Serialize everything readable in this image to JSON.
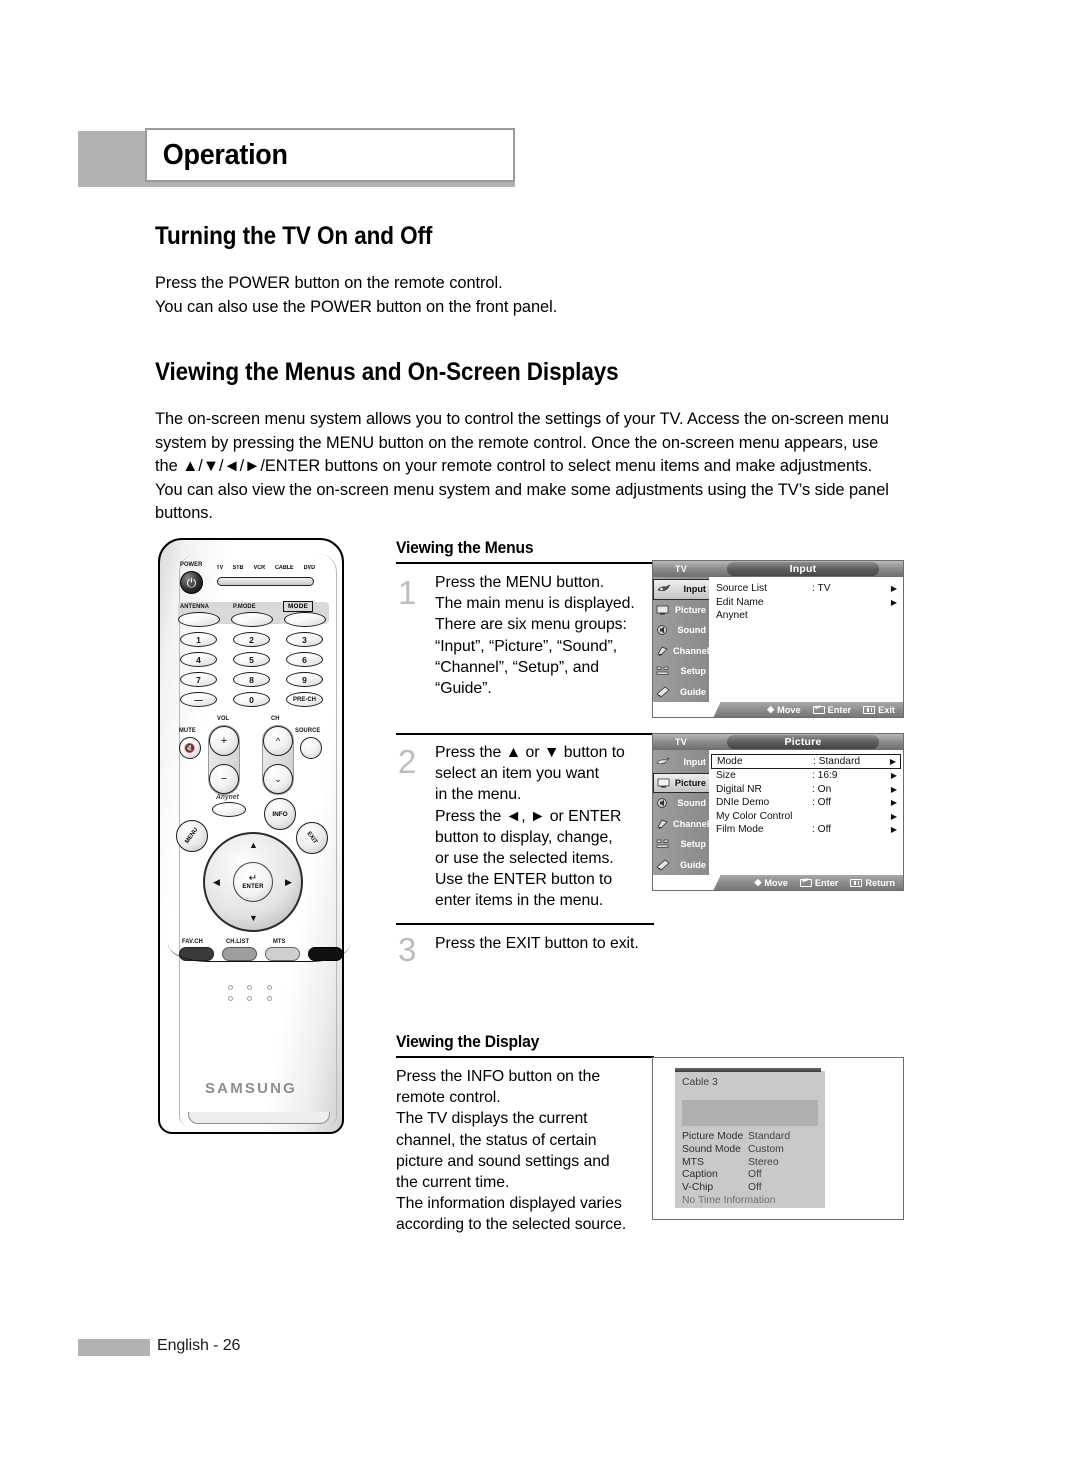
{
  "chapter": {
    "title": "Operation"
  },
  "sections": [
    {
      "heading": "Turning the TV On and Off",
      "body": "Press the POWER button on the remote control.\nYou can also use the POWER button on the front panel."
    },
    {
      "heading": "Viewing the Menus and On-Screen Displays",
      "body": "The on-screen menu system allows you to control the settings of your TV. Access the on-screen menu system by pressing the MENU button on the remote control. Once the on-screen menu appears, use the ▲/▼/◄/►/ENTER buttons on your remote control to select menu items and make adjustments. You can also view the on-screen menu system and make some adjustments using the TV’s side panel buttons."
    }
  ],
  "viewing_menus": {
    "heading": "Viewing the Menus",
    "steps": [
      {
        "num": "1",
        "text": "Press the MENU button.\nThe main menu is displayed.\nThere are six menu groups:\n“Input”, “Picture”, “Sound”,\n“Channel”, “Setup”, and\n“Guide”."
      },
      {
        "num": "2",
        "text": "Press the ▲ or ▼ button to\nselect an item you want\nin the menu.\nPress the ◄, ► or ENTER\nbutton to display, change,\nor use the selected items.\nUse the ENTER button to\nenter items in the menu."
      },
      {
        "num": "3",
        "text": "Press the EXIT button to exit."
      }
    ]
  },
  "viewing_display": {
    "heading": "Viewing the Display",
    "text": "Press the INFO button on the\nremote control.\nThe TV displays the current\nchannel, the status of certain\npicture and sound settings and\nthe current time.\nThe information displayed varies\naccording to the selected source."
  },
  "osd_menus": [
    {
      "tv_label": "TV",
      "title": "Input",
      "sidebar": [
        {
          "label": "Input",
          "icon": "input-icon",
          "selected": true
        },
        {
          "label": "Picture",
          "icon": "picture-icon",
          "selected": false
        },
        {
          "label": "Sound",
          "icon": "sound-icon",
          "selected": false
        },
        {
          "label": "Channel",
          "icon": "channel-icon",
          "selected": false
        },
        {
          "label": "Setup",
          "icon": "setup-icon",
          "selected": false
        },
        {
          "label": "Guide",
          "icon": "guide-icon",
          "selected": false
        }
      ],
      "rows": [
        {
          "key": "Source List",
          "value": ": TV",
          "arrow": "▶",
          "selected": false
        },
        {
          "key": "Edit Name",
          "value": "",
          "arrow": "▶",
          "selected": false
        },
        {
          "key": "Anynet",
          "value": "",
          "arrow": "",
          "selected": false
        }
      ],
      "footer": [
        {
          "icon": "move-icon",
          "label": "Move"
        },
        {
          "icon": "enter-icon",
          "label": "Enter"
        },
        {
          "icon": "exit-icon",
          "label": "Exit"
        }
      ]
    },
    {
      "tv_label": "TV",
      "title": "Picture",
      "sidebar": [
        {
          "label": "Input",
          "icon": "input-icon",
          "selected": false
        },
        {
          "label": "Picture",
          "icon": "picture-icon",
          "selected": true
        },
        {
          "label": "Sound",
          "icon": "sound-icon",
          "selected": false
        },
        {
          "label": "Channel",
          "icon": "channel-icon",
          "selected": false
        },
        {
          "label": "Setup",
          "icon": "setup-icon",
          "selected": false
        },
        {
          "label": "Guide",
          "icon": "guide-icon",
          "selected": false
        }
      ],
      "rows": [
        {
          "key": "Mode",
          "value": ": Standard",
          "arrow": "▶",
          "selected": true
        },
        {
          "key": "Size",
          "value": ": 16:9",
          "arrow": "▶",
          "selected": false
        },
        {
          "key": "Digital NR",
          "value": ": On",
          "arrow": "▶",
          "selected": false
        },
        {
          "key": "DNIe Demo",
          "value": ": Off",
          "arrow": "▶",
          "selected": false
        },
        {
          "key": "My Color Control",
          "value": "",
          "arrow": "▶",
          "selected": false
        },
        {
          "key": "Film Mode",
          "value": ": Off",
          "arrow": "▶",
          "selected": false
        }
      ],
      "footer": [
        {
          "icon": "move-icon",
          "label": "Move"
        },
        {
          "icon": "enter-icon",
          "label": "Enter"
        },
        {
          "icon": "return-icon",
          "label": "Return"
        }
      ]
    }
  ],
  "info_banner": {
    "channel": "Cable 3",
    "rows": [
      {
        "key": "Picture Mode",
        "value": "Standard"
      },
      {
        "key": "Sound Mode",
        "value": "Custom"
      },
      {
        "key": "MTS",
        "value": "Stereo"
      },
      {
        "key": "Caption",
        "value": "Off"
      },
      {
        "key": "V-Chip",
        "value": "Off"
      }
    ],
    "note": "No Time Information"
  },
  "remote": {
    "power_label": "POWER",
    "device_modes": [
      "TV",
      "STB",
      "VCR",
      "CABLE",
      "DVD"
    ],
    "fn_row": [
      "ANTENNA",
      "P.MODE",
      "MODE"
    ],
    "keypad": [
      "1",
      "2",
      "3",
      "4",
      "5",
      "6",
      "7",
      "8",
      "9",
      "—",
      "0",
      "PRE-CH"
    ],
    "vol_label": "VOL",
    "ch_label": "CH",
    "mute_label": "MUTE",
    "source_label": "SOURCE",
    "anynet_label": "Anynet",
    "info_label": "INFO",
    "menu_label": "MENU",
    "exit_label": "EXIT",
    "enter_label": "ENTER",
    "bottom_row": [
      "FAV.CH",
      "CH.LIST",
      "MTS"
    ],
    "brand": "SAMSUNG"
  },
  "footer": {
    "page": "English - 26"
  }
}
